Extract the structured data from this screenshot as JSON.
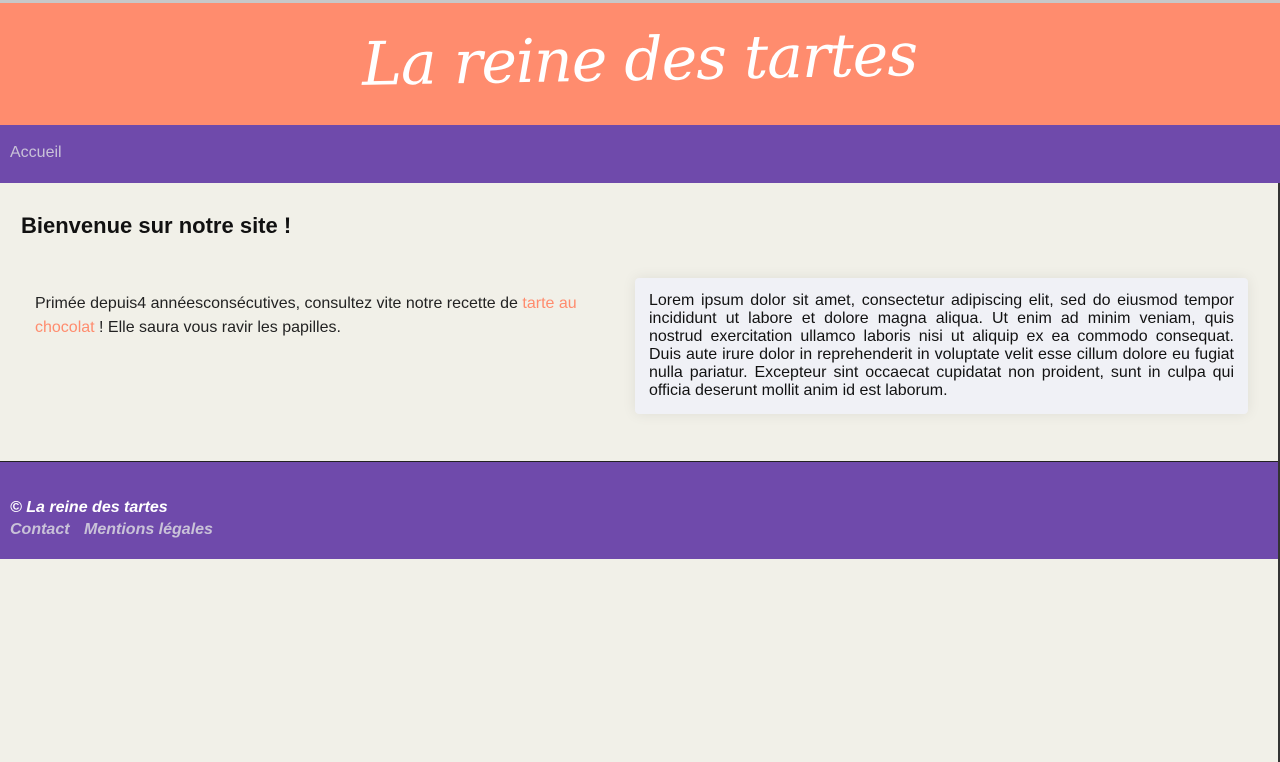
{
  "colors": {
    "header": "#ff8c6e",
    "nav": "#6f4aab",
    "background": "#f1f0e8",
    "link_accent": "#ff8c6e",
    "card": "#f0f1f6"
  },
  "header": {
    "brand": "La reine des tartes"
  },
  "nav": {
    "home_label": "Accueil"
  },
  "main": {
    "title": "Bienvenue sur notre site !",
    "intro_before": "Primée depuis4 annéesconsécutives, consultez vite notre recette de ",
    "intro_link": "tarte au chocolat",
    "intro_after": " ! Elle saura vous ravir les papilles.",
    "lorem": "Lorem ipsum dolor sit amet, consectetur adipiscing elit, sed do eiusmod tempor incididunt ut labore et dolore magna aliqua. Ut enim ad minim veniam, quis nostrud exercitation ullamco laboris nisi ut aliquip ex ea commodo consequat. Duis aute irure dolor in reprehenderit in voluptate velit esse cillum dolore eu fugiat nulla pariatur. Excepteur sint occaecat cupidatat non proident, sunt in culpa qui officia deserunt mollit anim id est laborum."
  },
  "footer": {
    "copyright": "© La reine des tartes",
    "links": [
      "Contact",
      "Mentions légales"
    ]
  }
}
